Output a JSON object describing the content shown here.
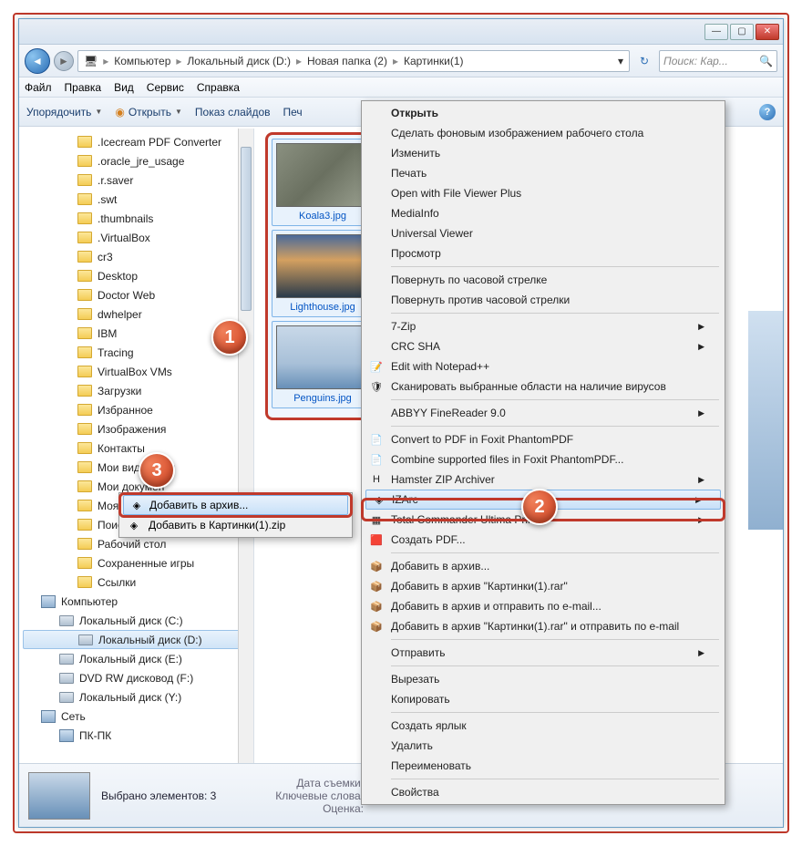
{
  "window": {
    "min": "—",
    "max": "▢",
    "close": "✕"
  },
  "breadcrumb": {
    "root_icon": "🖥",
    "parts": [
      "Компьютер",
      "Локальный диск (D:)",
      "Новая папка (2)",
      "Картинки(1)"
    ]
  },
  "addrbar": {
    "dropdown": "▾",
    "refresh": "↻",
    "search_placeholder": "Поиск: Кар...",
    "search_icon": "🔍"
  },
  "menubar": [
    "Файл",
    "Правка",
    "Вид",
    "Сервис",
    "Справка"
  ],
  "toolbar": {
    "organize": "Упорядочить",
    "open": "Открыть",
    "slideshow": "Показ слайдов",
    "print": "Печ",
    "help": "?"
  },
  "sidebar": {
    "items": [
      {
        "label": ".Icecream PDF Converter",
        "lvl": 2,
        "ico": "folder"
      },
      {
        "label": ".oracle_jre_usage",
        "lvl": 2,
        "ico": "folder"
      },
      {
        "label": ".r.saver",
        "lvl": 2,
        "ico": "folder"
      },
      {
        "label": ".swt",
        "lvl": 2,
        "ico": "folder"
      },
      {
        "label": ".thumbnails",
        "lvl": 2,
        "ico": "folder"
      },
      {
        "label": ".VirtualBox",
        "lvl": 2,
        "ico": "folder"
      },
      {
        "label": "cr3",
        "lvl": 2,
        "ico": "folder"
      },
      {
        "label": "Desktop",
        "lvl": 2,
        "ico": "folder"
      },
      {
        "label": "Doctor Web",
        "lvl": 2,
        "ico": "folder"
      },
      {
        "label": "dwhelper",
        "lvl": 2,
        "ico": "folder"
      },
      {
        "label": "IBM",
        "lvl": 2,
        "ico": "folder"
      },
      {
        "label": "Tracing",
        "lvl": 2,
        "ico": "folder"
      },
      {
        "label": "VirtualBox VMs",
        "lvl": 2,
        "ico": "folder"
      },
      {
        "label": "Загрузки",
        "lvl": 2,
        "ico": "folder"
      },
      {
        "label": "Избранное",
        "lvl": 2,
        "ico": "folder"
      },
      {
        "label": "Изображения",
        "lvl": 2,
        "ico": "folder"
      },
      {
        "label": "Контакты",
        "lvl": 2,
        "ico": "folder"
      },
      {
        "label": "Мои видеозапи",
        "lvl": 2,
        "ico": "folder"
      },
      {
        "label": "Мои докумен",
        "lvl": 2,
        "ico": "folder"
      },
      {
        "label": "Моя музыка",
        "lvl": 2,
        "ico": "folder"
      },
      {
        "label": "Поиски",
        "lvl": 2,
        "ico": "folder"
      },
      {
        "label": "Рабочий стол",
        "lvl": 2,
        "ico": "folder"
      },
      {
        "label": "Сохраненные игры",
        "lvl": 2,
        "ico": "folder"
      },
      {
        "label": "Ссылки",
        "lvl": 2,
        "ico": "folder"
      },
      {
        "label": "Компьютер",
        "lvl": 0,
        "ico": "comp"
      },
      {
        "label": "Локальный диск (C:)",
        "lvl": 1,
        "ico": "drive"
      },
      {
        "label": "Локальный диск (D:)",
        "lvl": 1,
        "ico": "drive",
        "selected": true
      },
      {
        "label": "Локальный диск (E:)",
        "lvl": 1,
        "ico": "drive"
      },
      {
        "label": "DVD RW дисковод (F:)",
        "lvl": 1,
        "ico": "drive"
      },
      {
        "label": "Локальный диск (Y:)",
        "lvl": 1,
        "ico": "drive"
      },
      {
        "label": "Сеть",
        "lvl": 0,
        "ico": "comp"
      },
      {
        "label": "ПК-ПК",
        "lvl": 1,
        "ico": "comp"
      }
    ]
  },
  "thumbs": [
    {
      "name": "Koala3.jpg",
      "cls": "koala"
    },
    {
      "name": "Lighthouse.jpg",
      "cls": "light"
    },
    {
      "name": "Penguins.jpg",
      "cls": "peng"
    }
  ],
  "context": {
    "groups": [
      [
        {
          "label": "Открыть",
          "bold": true
        },
        {
          "label": "Сделать фоновым изображением рабочего стола"
        },
        {
          "label": "Изменить"
        },
        {
          "label": "Печать"
        },
        {
          "label": "Open with File Viewer Plus"
        },
        {
          "label": "MediaInfo"
        },
        {
          "label": "Universal Viewer"
        },
        {
          "label": "Просмотр"
        }
      ],
      [
        {
          "label": "Повернуть по часовой стрелке"
        },
        {
          "label": "Повернуть против часовой стрелки"
        }
      ],
      [
        {
          "label": "7-Zip",
          "sub": true
        },
        {
          "label": "CRC SHA",
          "sub": true
        },
        {
          "label": "Edit with Notepad++",
          "icon": "📝"
        },
        {
          "label": "Сканировать выбранные области на наличие вирусов",
          "icon": "🛡"
        }
      ],
      [
        {
          "label": "ABBYY FineReader 9.0",
          "sub": true
        }
      ],
      [
        {
          "label": "Convert to PDF in Foxit PhantomPDF",
          "icon": "📄"
        },
        {
          "label": "Combine supported files in Foxit PhantomPDF...",
          "icon": "📄"
        },
        {
          "label": "Hamster ZIP Archiver",
          "icon": "H",
          "sub": true
        },
        {
          "label": "IZArc",
          "icon": "◈",
          "sub": true,
          "hl": true
        },
        {
          "label": "Total Commander Ultima Prime",
          "icon": "▦",
          "sub": true
        },
        {
          "label": "Создать PDF...",
          "icon": "🟥"
        }
      ],
      [
        {
          "label": "Добавить в архив...",
          "icon": "📦"
        },
        {
          "label": "Добавить в архив \"Картинки(1).rar\"",
          "icon": "📦"
        },
        {
          "label": "Добавить в архив и отправить по e-mail...",
          "icon": "📦"
        },
        {
          "label": "Добавить в архив \"Картинки(1).rar\" и отправить по e-mail",
          "icon": "📦"
        }
      ],
      [
        {
          "label": "Отправить",
          "sub": true
        }
      ],
      [
        {
          "label": "Вырезать"
        },
        {
          "label": "Копировать"
        }
      ],
      [
        {
          "label": "Создать ярлык"
        },
        {
          "label": "Удалить"
        },
        {
          "label": "Переименовать"
        }
      ],
      [
        {
          "label": "Свойства"
        }
      ]
    ]
  },
  "submenu": [
    {
      "label": "Добавить в архив...",
      "hl": true,
      "icon": "◈"
    },
    {
      "label": "Добавить в Картинки(1).zip",
      "icon": "◈"
    }
  ],
  "status": {
    "selected": "Выбрано элементов: 3",
    "meta1": "Дата съемки:",
    "meta2": "Ключевые слова:",
    "meta3": "Оценка:"
  },
  "badges": {
    "b1": "1",
    "b2": "2",
    "b3": "3"
  }
}
